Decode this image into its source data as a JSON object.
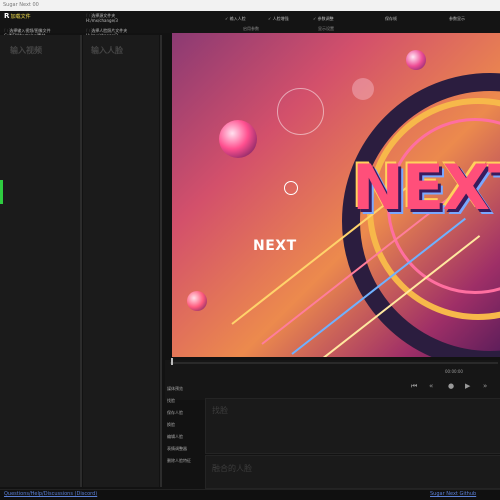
{
  "window": {
    "title": "Sugar Next 00"
  },
  "topbar": {
    "load_file": "加载文件",
    "select_source_folder": "选择源文件夹",
    "select_source_path": "H:/mx/change/3",
    "select_video_folder": "选择输入视频/图像文件",
    "select_video_path": "C:/NEW/tests/ac/素材",
    "select_face_folder": "选择人脸照片文件夹",
    "select_face_path": "H:/mx/change/3",
    "opt_input_face": "输入人脸",
    "opt_face_enhance": "人脸增强",
    "opt_param_adjust": "参数调整",
    "opt_keep_frames": "保存帧",
    "opt_show_params": "参数显示",
    "sub_label_1": "启用参数",
    "sub_label_2": "显示设置"
  },
  "left_panels": {
    "input_video_placeholder": "输入视频",
    "input_face_placeholder": "输入人脸"
  },
  "preview": {
    "poster_text_small": "NEXT",
    "poster_text_large": "NEXT",
    "timecode": "00:00:00"
  },
  "side_menu": [
    "媒体预览",
    "找脸",
    "保存人脸",
    "换脸",
    "编辑人脸",
    "表情调整器",
    "删除人脸特征"
  ],
  "boxes": {
    "find_face_label": "找脸",
    "merged_face_label": "融合的人脸"
  },
  "footer": {
    "left_link": "Questions/Help/Discussions (Discord)",
    "right_link": "Sugar Next Github"
  },
  "colors": {
    "accent_green": "#2ecc40",
    "link_blue": "#5a7fd6",
    "background": "#121212"
  }
}
